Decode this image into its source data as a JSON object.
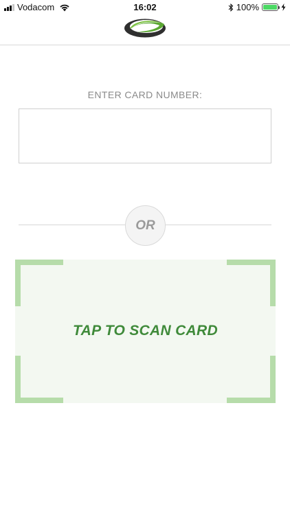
{
  "status_bar": {
    "carrier": "Vodacom",
    "time": "16:02",
    "battery_percent": "100%"
  },
  "header": {
    "logo_icon": "brand-logo-icon"
  },
  "card_entry": {
    "label": "ENTER CARD NUMBER:",
    "value": "",
    "placeholder": ""
  },
  "divider": {
    "or_label": "OR"
  },
  "scan": {
    "label": "TAP TO SCAN CARD"
  },
  "colors": {
    "accent_green": "#3f8a3a",
    "corner_green": "#b6dcaa",
    "scan_background": "#f3f8f1",
    "battery_green": "#4cd964"
  }
}
